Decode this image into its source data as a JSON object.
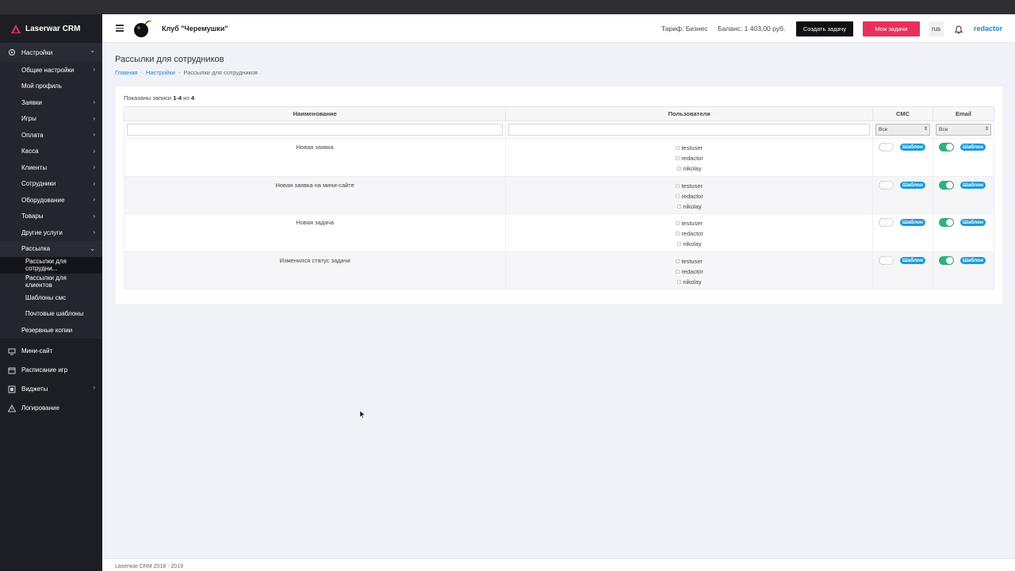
{
  "brand": {
    "name": "Laserwar CRM"
  },
  "header": {
    "club_name": "Клуб \"Черемушки\"",
    "tariff": "Тариф: Бизнес",
    "balance": "Баланс: 1 403,00 руб.",
    "create_task": "Создать задачу",
    "my_tasks": "Мои задачи",
    "lang": "rus",
    "user": "redactor"
  },
  "sidebar": {
    "settings": "Настройки",
    "items": [
      {
        "label": "Общие настройки",
        "arrow": true
      },
      {
        "label": "Мой профиль",
        "arrow": false
      },
      {
        "label": "Заявки",
        "arrow": true
      },
      {
        "label": "Игры",
        "arrow": true
      },
      {
        "label": "Оплата",
        "arrow": true
      },
      {
        "label": "Касса",
        "arrow": true
      },
      {
        "label": "Клиенты",
        "arrow": true
      },
      {
        "label": "Сотрудники",
        "arrow": true
      },
      {
        "label": "Оборудование",
        "arrow": true
      },
      {
        "label": "Товары",
        "arrow": true
      },
      {
        "label": "Другие услуги",
        "arrow": true
      },
      {
        "label": "Рассылка",
        "arrow": true
      }
    ],
    "mailing_sub": [
      "Рассылки для сотрудни...",
      "Рассылки для клиентов",
      "Шаблоны смс",
      "Почтовые шаблоны"
    ],
    "backups": "Резервные копии",
    "mini_site": "Мини-сайт",
    "schedule": "Расписание игр",
    "widgets": "Виджеты",
    "logging": "Логирование"
  },
  "page": {
    "title": "Рассылки для сотрудников",
    "breadcrumb": [
      "Главная",
      "Настройки",
      "Рассылки для сотрудников"
    ],
    "summary_prefix": "Показаны записи ",
    "summary_range": "1-4",
    "summary_mid": " из ",
    "summary_total": "4",
    "summary_end": "."
  },
  "table": {
    "headers": {
      "name": "Наименование",
      "users": "Пользователи",
      "sms": "СМС",
      "email": "Email"
    },
    "filter_sms": "Все",
    "filter_email": "Все",
    "template_label": "Шаблон",
    "users": [
      "testuser",
      "redactor",
      "nikolay"
    ],
    "rows": [
      {
        "name": "Новая заявка",
        "sms_on": false,
        "email_on": true
      },
      {
        "name": "Новая заявка на мини-сайте",
        "sms_on": false,
        "email_on": true
      },
      {
        "name": "Новая задача",
        "sms_on": false,
        "email_on": true
      },
      {
        "name": "Изменился статус задачи",
        "sms_on": false,
        "email_on": true
      }
    ]
  },
  "footer": {
    "text": "Laserwar CRM 2018 - 2019"
  },
  "colors": {
    "accent": "#2486c7",
    "danger": "#e8315a",
    "success": "#2db37a",
    "sidebar": "#1d1e24"
  }
}
